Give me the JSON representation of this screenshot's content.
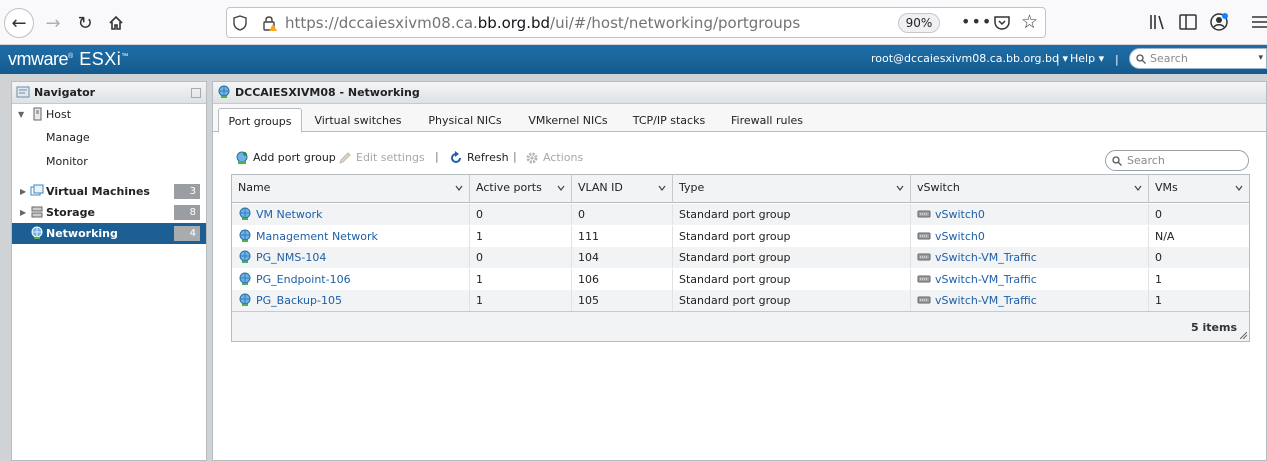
{
  "browser": {
    "url_prefix": "https://dccaiesxivm08.ca.",
    "url_host": "bb.org.bd",
    "url_path": "/ui/#/host/networking/portgroups",
    "zoom": "90%"
  },
  "header": {
    "brand_vm": "vmware",
    "brand_product": "ESXi",
    "user": "root@dccaiesxivm08.ca.bb.org.bd ▾",
    "separator": "|",
    "help": "Help ▾",
    "search_placeholder": "Search"
  },
  "navigator": {
    "title": "Navigator",
    "host": "Host",
    "manage": "Manage",
    "monitor": "Monitor",
    "items": [
      {
        "label": "Virtual Machines",
        "count": "3"
      },
      {
        "label": "Storage",
        "count": "8"
      },
      {
        "label": "Networking",
        "count": "4"
      }
    ]
  },
  "main": {
    "title": "DCCAIESXIVM08 - Networking",
    "tabs": [
      "Port groups",
      "Virtual switches",
      "Physical NICs",
      "VMkernel NICs",
      "TCP/IP stacks",
      "Firewall rules"
    ],
    "toolbar": {
      "add": "Add port group",
      "edit": "Edit settings",
      "refresh": "Refresh",
      "actions": "Actions",
      "sep": "|"
    },
    "search_placeholder": "Search",
    "columns": [
      "Name",
      "Active ports",
      "VLAN ID",
      "Type",
      "vSwitch",
      "VMs"
    ],
    "rows": [
      {
        "name": "VM Network",
        "active": "0",
        "vlan": "0",
        "type": "Standard port group",
        "vswitch": "vSwitch0",
        "vms": "0"
      },
      {
        "name": "Management Network",
        "active": "1",
        "vlan": "111",
        "type": "Standard port group",
        "vswitch": "vSwitch0",
        "vms": "N/A"
      },
      {
        "name": "PG_NMS-104",
        "active": "0",
        "vlan": "104",
        "type": "Standard port group",
        "vswitch": "vSwitch-VM_Traffic",
        "vms": "0"
      },
      {
        "name": "PG_Endpoint-106",
        "active": "1",
        "vlan": "106",
        "type": "Standard port group",
        "vswitch": "vSwitch-VM_Traffic",
        "vms": "1"
      },
      {
        "name": "PG_Backup-105",
        "active": "1",
        "vlan": "105",
        "type": "Standard port group",
        "vswitch": "vSwitch-VM_Traffic",
        "vms": "1"
      }
    ],
    "footer_count": "5 items"
  },
  "colors": {
    "header_blue": "#1a659c",
    "selected_blue": "#1d5f92",
    "link_blue": "#1d5fa8"
  }
}
